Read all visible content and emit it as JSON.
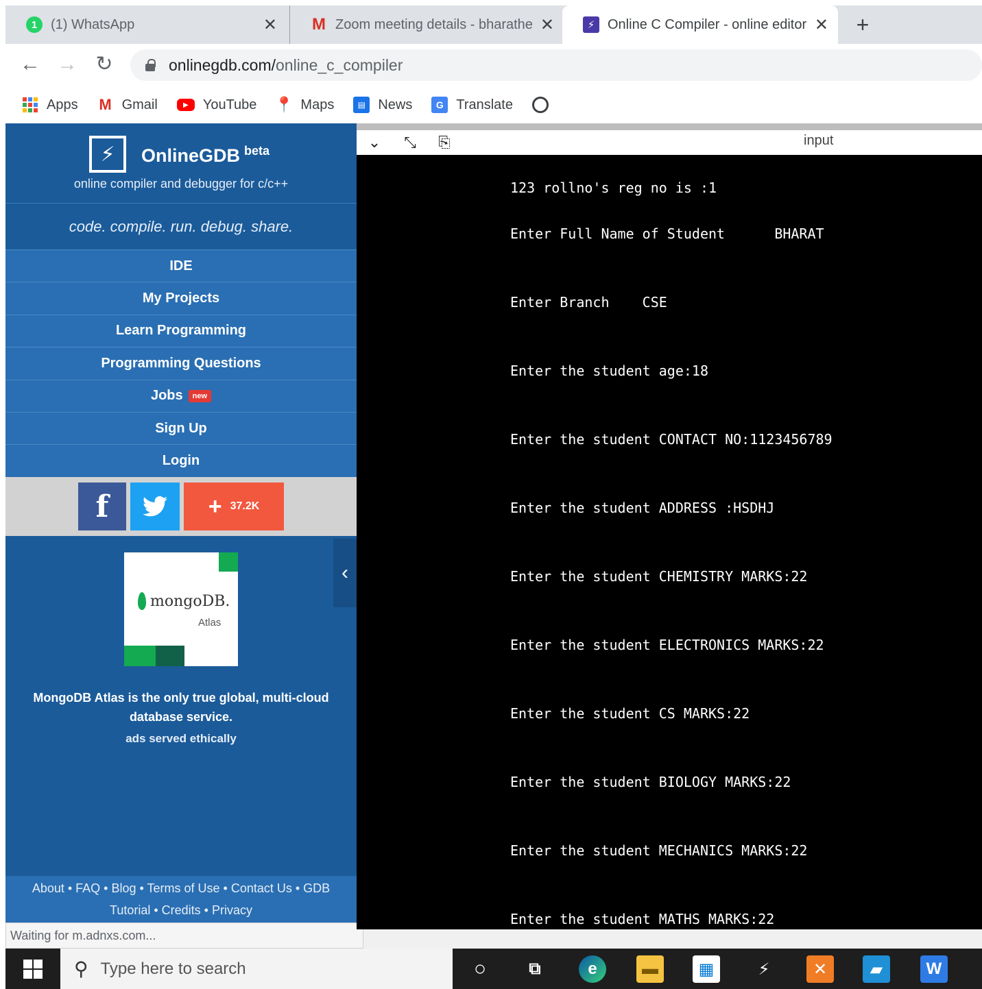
{
  "browser": {
    "tabs": [
      {
        "title": "(1) WhatsApp",
        "favicon": "whatsapp-icon",
        "favicon_text": "1"
      },
      {
        "title": "Zoom meeting details - bharathe",
        "favicon": "gmail-icon",
        "favicon_text": "M"
      },
      {
        "title": "Online C Compiler - online editor",
        "favicon": "onlinegdb-icon",
        "favicon_text": "⚡"
      }
    ],
    "new_tab": "+",
    "url_host": "onlinegdb.com/",
    "url_path": "online_c_compiler",
    "bookmarks": [
      {
        "label": "Apps",
        "icon": "apps-grid-icon"
      },
      {
        "label": "Gmail",
        "icon": "gmail-icon",
        "glyph": "M"
      },
      {
        "label": "YouTube",
        "icon": "youtube-icon",
        "glyph": "▶"
      },
      {
        "label": "Maps",
        "icon": "maps-icon",
        "glyph": "📍"
      },
      {
        "label": "News",
        "icon": "news-icon",
        "glyph": "▤"
      },
      {
        "label": "Translate",
        "icon": "translate-icon",
        "glyph": "G"
      }
    ]
  },
  "sidebar": {
    "brand_name": "OnlineGDB",
    "brand_sup": "beta",
    "tagline": "online compiler and debugger for c/c++",
    "motto": "code. compile. run. debug. share.",
    "menu": [
      {
        "label": "IDE"
      },
      {
        "label": "My Projects"
      },
      {
        "label": "Learn Programming"
      },
      {
        "label": "Programming Questions"
      },
      {
        "label": "Jobs",
        "badge": "new"
      },
      {
        "label": "Sign Up"
      },
      {
        "label": "Login"
      }
    ],
    "social": {
      "plus_count": "37.2K"
    },
    "ad": {
      "logo_text": "mongoDB.",
      "logo_sub": "Atlas",
      "text": "MongoDB Atlas is the only true global, multi-cloud database service.",
      "note": "ads served ethically"
    },
    "footer": {
      "line1": "About • FAQ • Blog • Terms of Use • Contact Us • GDB",
      "line2": "Tutorial • Credits • Privacy"
    }
  },
  "status_text": "Waiting for m.adnxs.com...",
  "console": {
    "input_label": "input",
    "lines": [
      "123 rollno's reg no is :1",
      "Enter Full Name of Student      BHARAT",
      "Enter Branch    CSE",
      "Enter the student age:18",
      "Enter the student CONTACT NO:1123456789",
      "Enter the student ADDRESS :HSDHJ",
      "Enter the student CHEMISTRY MARKS:22",
      "Enter the student ELECTRONICS MARKS:22",
      "Enter the student CS MARKS:22",
      "Enter the student BIOLOGY MARKS:22",
      "Enter the student MECHANICS MARKS:22",
      "Enter the student MATHS MARKS:22"
    ]
  },
  "taskbar": {
    "search_placeholder": "Type here to search"
  }
}
